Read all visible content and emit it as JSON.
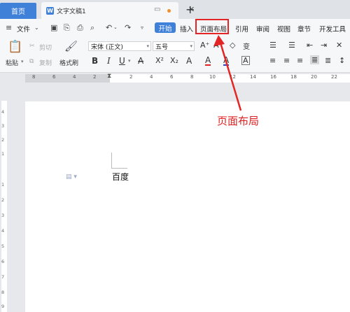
{
  "tabs": {
    "home": "首页",
    "doc_icon_letter": "W",
    "doc": "文字文稿1",
    "new_tab": "+"
  },
  "menubar": {
    "file": "文件",
    "start": "开始",
    "insert": "插入",
    "layout": "页面布局",
    "references": "引用",
    "review": "审阅",
    "view": "视图",
    "section": "章节",
    "developer": "开发工具"
  },
  "ribbon": {
    "paste": "粘贴",
    "cut": "剪切",
    "copy": "复制",
    "format_painter": "格式刷",
    "font_name": "宋体 (正文)",
    "font_size": "五号",
    "bold": "B",
    "italic": "I",
    "underline": "U",
    "strikethrough": "A",
    "superscript": "X²",
    "subscript": "X₂",
    "text_effect": "A",
    "highlight": "A",
    "font_color": "A",
    "char_border": "A",
    "grow_font": "A⁺",
    "shrink_font": "A⁻",
    "clear_format": "◇",
    "phonetic": "变"
  },
  "ruler": {
    "h_numbers": [
      "8",
      "6",
      "4",
      "2",
      "2",
      "4",
      "6",
      "8",
      "10",
      "12",
      "14",
      "16",
      "18",
      "20",
      "22"
    ],
    "v_numbers": [
      "4",
      "3",
      "2",
      "1",
      "1",
      "2",
      "3",
      "4",
      "5",
      "6",
      "7",
      "8",
      "9",
      "10"
    ]
  },
  "document": {
    "body_text": "百度"
  },
  "annotation": {
    "label": "页面布局",
    "color": "#e02020"
  },
  "colors": {
    "accent": "#3f80d8",
    "annotation_red": "#e32525",
    "modified_dot": "#f0902a"
  }
}
